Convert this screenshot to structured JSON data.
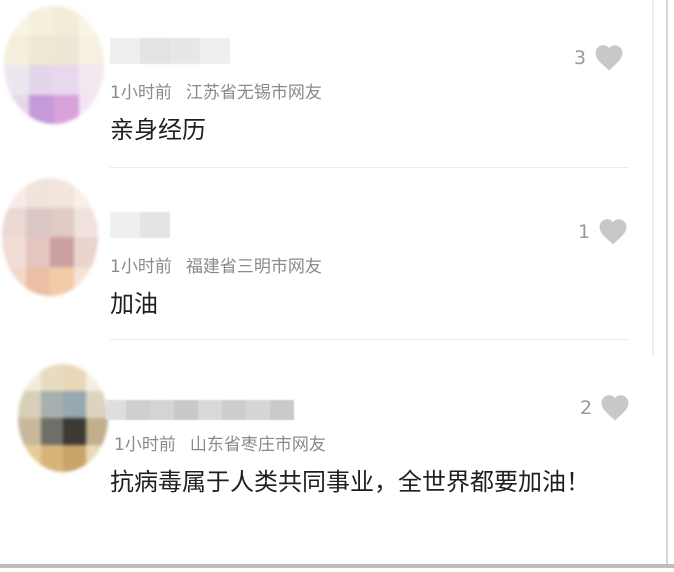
{
  "comments": [
    {
      "time": "1小时前",
      "location": "江苏省无锡市网友",
      "text": "亲身经历",
      "likes": "3"
    },
    {
      "time": "1小时前",
      "location": "福建省三明市网友",
      "text": "加油",
      "likes": "1"
    },
    {
      "time": "1小时前",
      "location": "山东省枣庄市网友",
      "text": "抗病毒属于人类共同事业，全世界都要加油！",
      "likes": "2"
    }
  ],
  "colors": {
    "meta": "#8a8a8a",
    "text": "#1f1f1f",
    "like_icon": "#c8c8c8"
  },
  "icons": {
    "like": "heart-icon"
  }
}
